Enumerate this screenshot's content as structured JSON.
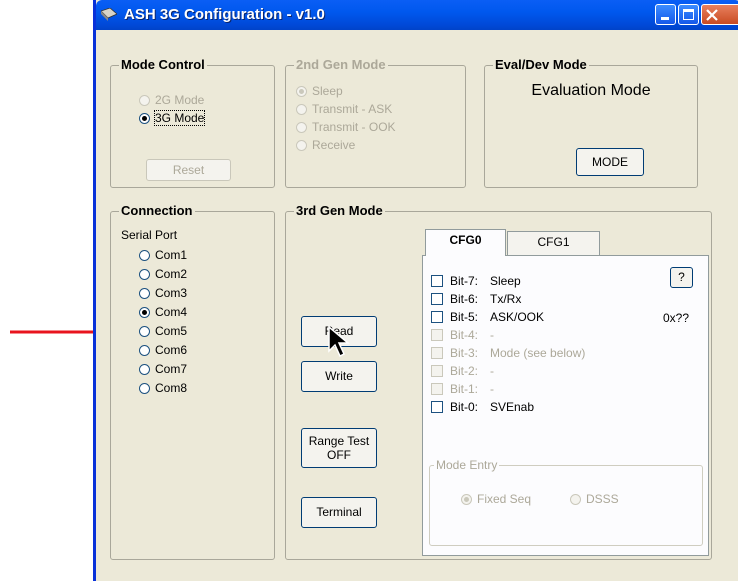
{
  "window": {
    "title": "ASH 3G Configuration - v1.0"
  },
  "mode_control": {
    "label": "Mode Control",
    "options": [
      "2G Mode",
      "3G Mode"
    ],
    "selected": "3G Mode",
    "reset_label": "Reset"
  },
  "gen2_mode": {
    "label": "2nd Gen Mode",
    "options": [
      "Sleep",
      "Transmit - ASK",
      "Transmit - OOK",
      "Receive"
    ],
    "selected": "Sleep"
  },
  "eval_dev": {
    "label": "Eval/Dev Mode",
    "status": "Evaluation Mode",
    "button_label": "MODE"
  },
  "connection": {
    "label": "Connection",
    "serial_label": "Serial Port",
    "ports": [
      "Com1",
      "Com2",
      "Com3",
      "Com4",
      "Com5",
      "Com6",
      "Com7",
      "Com8"
    ],
    "selected": "Com4"
  },
  "gen3_mode": {
    "label": "3rd Gen Mode",
    "read_label": "Read",
    "write_label": "Write",
    "range_test_label_1": "Range Test",
    "range_test_label_2": "OFF",
    "terminal_label": "Terminal"
  },
  "tabs": {
    "cfg0": "CFG0",
    "cfg1": "CFG1",
    "active": "CFG0"
  },
  "cfg0": {
    "bits": [
      {
        "bit": "Bit-7:",
        "desc": "Sleep"
      },
      {
        "bit": "Bit-6:",
        "desc": "Tx/Rx"
      },
      {
        "bit": "Bit-5:",
        "desc": "ASK/OOK"
      },
      {
        "bit": "Bit-4:",
        "desc": "-"
      },
      {
        "bit": "Bit-3:",
        "desc": "Mode (see below)"
      },
      {
        "bit": "Bit-2:",
        "desc": "-"
      },
      {
        "bit": "Bit-1:",
        "desc": "-"
      },
      {
        "bit": "Bit-0:",
        "desc": "SVEnab"
      }
    ],
    "help_label": "?",
    "hex_value": "0x??",
    "mode_entry": {
      "label": "Mode Entry",
      "options": [
        "Fixed Seq",
        "DSSS"
      ],
      "selected": "Fixed Seq"
    }
  },
  "colors": {
    "annotation_arrow": "#e8141e",
    "title_bar": "#0058ee"
  }
}
